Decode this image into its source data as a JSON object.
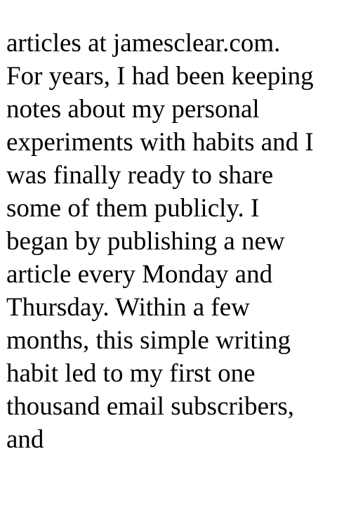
{
  "document": {
    "lines": [
      "articles at jamesclear.com.",
      "For years, I had been keeping",
      "notes about my personal",
      "experiments with habits and I",
      "was finally ready to share",
      "some of them publicly. I",
      "began by publishing a new",
      "article every Monday and",
      "Thursday. Within a few",
      "months, this simple writing",
      "habit led to my first one",
      "thousand email subscribers,",
      "and"
    ]
  }
}
